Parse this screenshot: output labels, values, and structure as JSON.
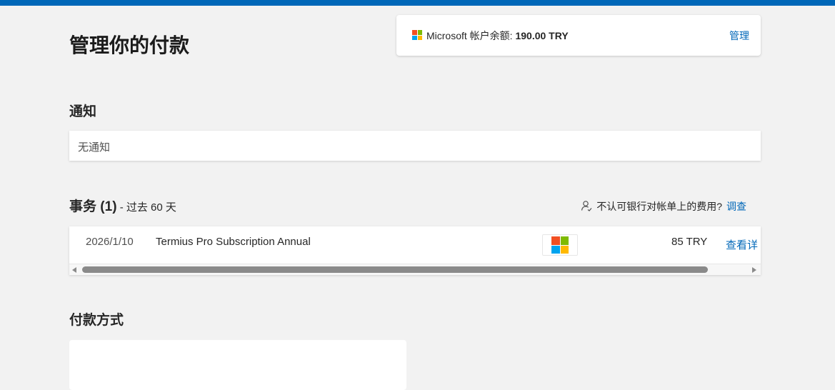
{
  "header": {
    "title": "管理你的付款"
  },
  "balance": {
    "label": "Microsoft 帐户余额: ",
    "amount": "190.00 TRY",
    "manage_label": "管理"
  },
  "notifications": {
    "heading": "通知",
    "empty_text": "无通知"
  },
  "transactions": {
    "heading": "事务",
    "count": "(1)",
    "range": " - 过去 60 天",
    "dispute_text": "不认可银行对帐单上的费用?",
    "dispute_link": "调查",
    "rows": [
      {
        "date": "2026/1/10",
        "description": "Termius Pro Subscription Annual",
        "merchant_logo": "microsoft-logo",
        "amount": "85 TRY",
        "details_label": "查看详"
      }
    ]
  },
  "payment_methods": {
    "heading": "付款方式"
  },
  "colors": {
    "accent": "#0067b8",
    "background": "#f2f2f2",
    "ms_red": "#f25022",
    "ms_green": "#7fba00",
    "ms_blue": "#00a4ef",
    "ms_yellow": "#ffb900"
  }
}
